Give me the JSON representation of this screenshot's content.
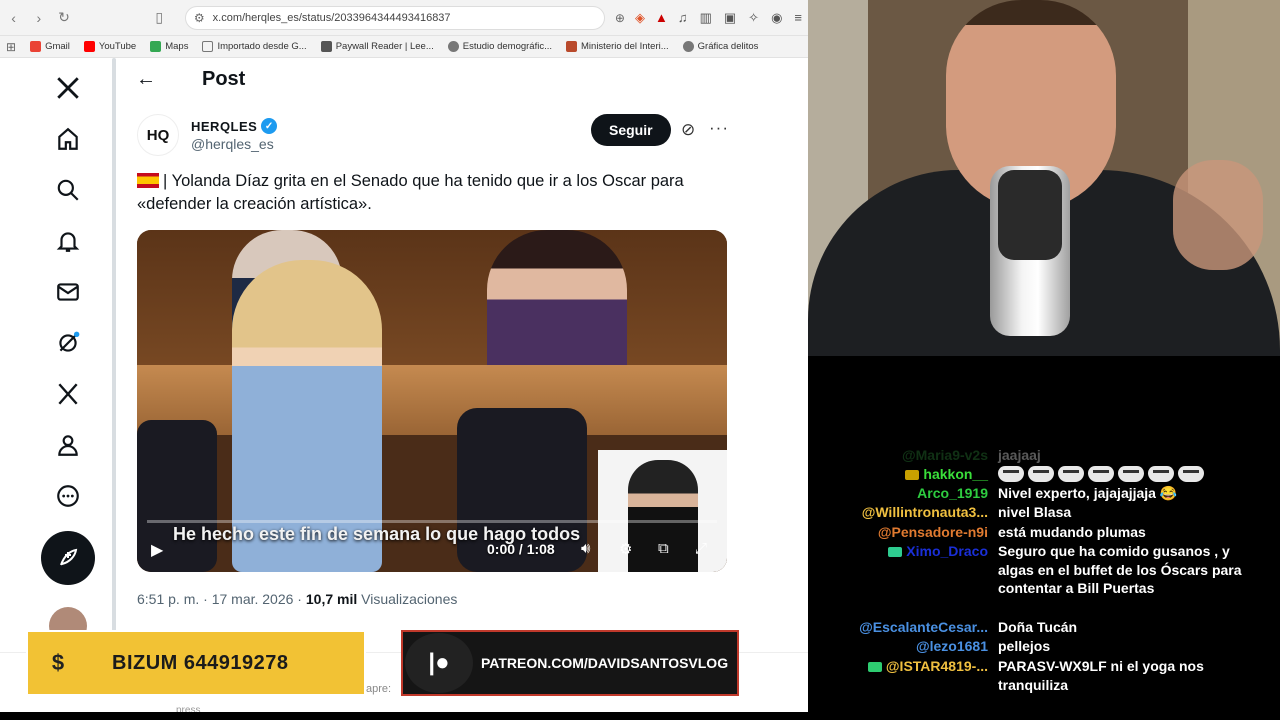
{
  "browser": {
    "url": "x.com/herqles_es/status/2033964344493416837",
    "bookmarks": [
      {
        "label": "Gmail",
        "color": "#ea4335"
      },
      {
        "label": "YouTube",
        "color": "#ff0000"
      },
      {
        "label": "Maps",
        "color": "#34a853"
      },
      {
        "label": "Importado desde G...",
        "color": "#888888"
      },
      {
        "label": "Paywall Reader | Lee...",
        "color": "#555555"
      },
      {
        "label": "Estudio demográfic...",
        "color": "#777777"
      },
      {
        "label": "Ministerio del Interi...",
        "color": "#b94a2c"
      },
      {
        "label": "Gráfica delitos",
        "color": "#777777"
      }
    ]
  },
  "x": {
    "column_title": "Post",
    "author": {
      "initials": "HQ",
      "name": "HERQLES",
      "handle": "@herqles_es"
    },
    "follow_label": "Seguir",
    "tweet_text": "| Yolanda Díaz grita en el Senado que ha tenido que ir a los Oscar para «defender la creación artística».",
    "video": {
      "caption": "He hecho este fin de semana lo que hago todos",
      "time": "0:00 / 1:08"
    },
    "meta": {
      "time": "6:51 p. m. · 17 mar. 2026 · ",
      "views_count": "10,7 mil",
      "views_label": " Visualizaciones"
    },
    "below_partial": "apre:",
    "below_partial2": "press"
  },
  "overlays": {
    "bizum": "BIZUM 644919278",
    "patreon": "PATREON.COM/DAVIDSANTOSVLOG"
  },
  "chat": [
    {
      "user": "@Maria9-v2s",
      "color": "#2e8b3a",
      "msg": "jaajaaj",
      "faded": true
    },
    {
      "user": "hakkon__",
      "color": "#3adf3a",
      "msg": "",
      "emotes": 7,
      "badge": "#c8a000"
    },
    {
      "user": "Arco_1919",
      "color": "#2ecc40",
      "msg": "Nivel experto, jajajajjaja 😂"
    },
    {
      "user": "@Willintronauta3...",
      "color": "#f0c040",
      "msg": "nivel Blasa"
    },
    {
      "user": "@Pensadore-n9i",
      "color": "#e07a30",
      "msg": "está mudando plumas"
    },
    {
      "user": "Ximo_Draco",
      "color": "#1a2fd8",
      "msg": "Seguro que ha comido gusanos , y algas en el buffet de los Óscars para contentar a Bill Puertas",
      "badge": "#2ecc90"
    },
    {
      "user": "@EscalanteCesar...",
      "color": "#4a90e2",
      "msg": "Doña Tucán"
    },
    {
      "user": "@lezo1681",
      "color": "#4a90e2",
      "msg": "pellejos"
    },
    {
      "user": "@ISTAR4819-...",
      "color": "#f0c040",
      "msg": "PARASV-WX9LF ni el yoga nos tranquiliza",
      "badge": "#2ecc71"
    }
  ]
}
